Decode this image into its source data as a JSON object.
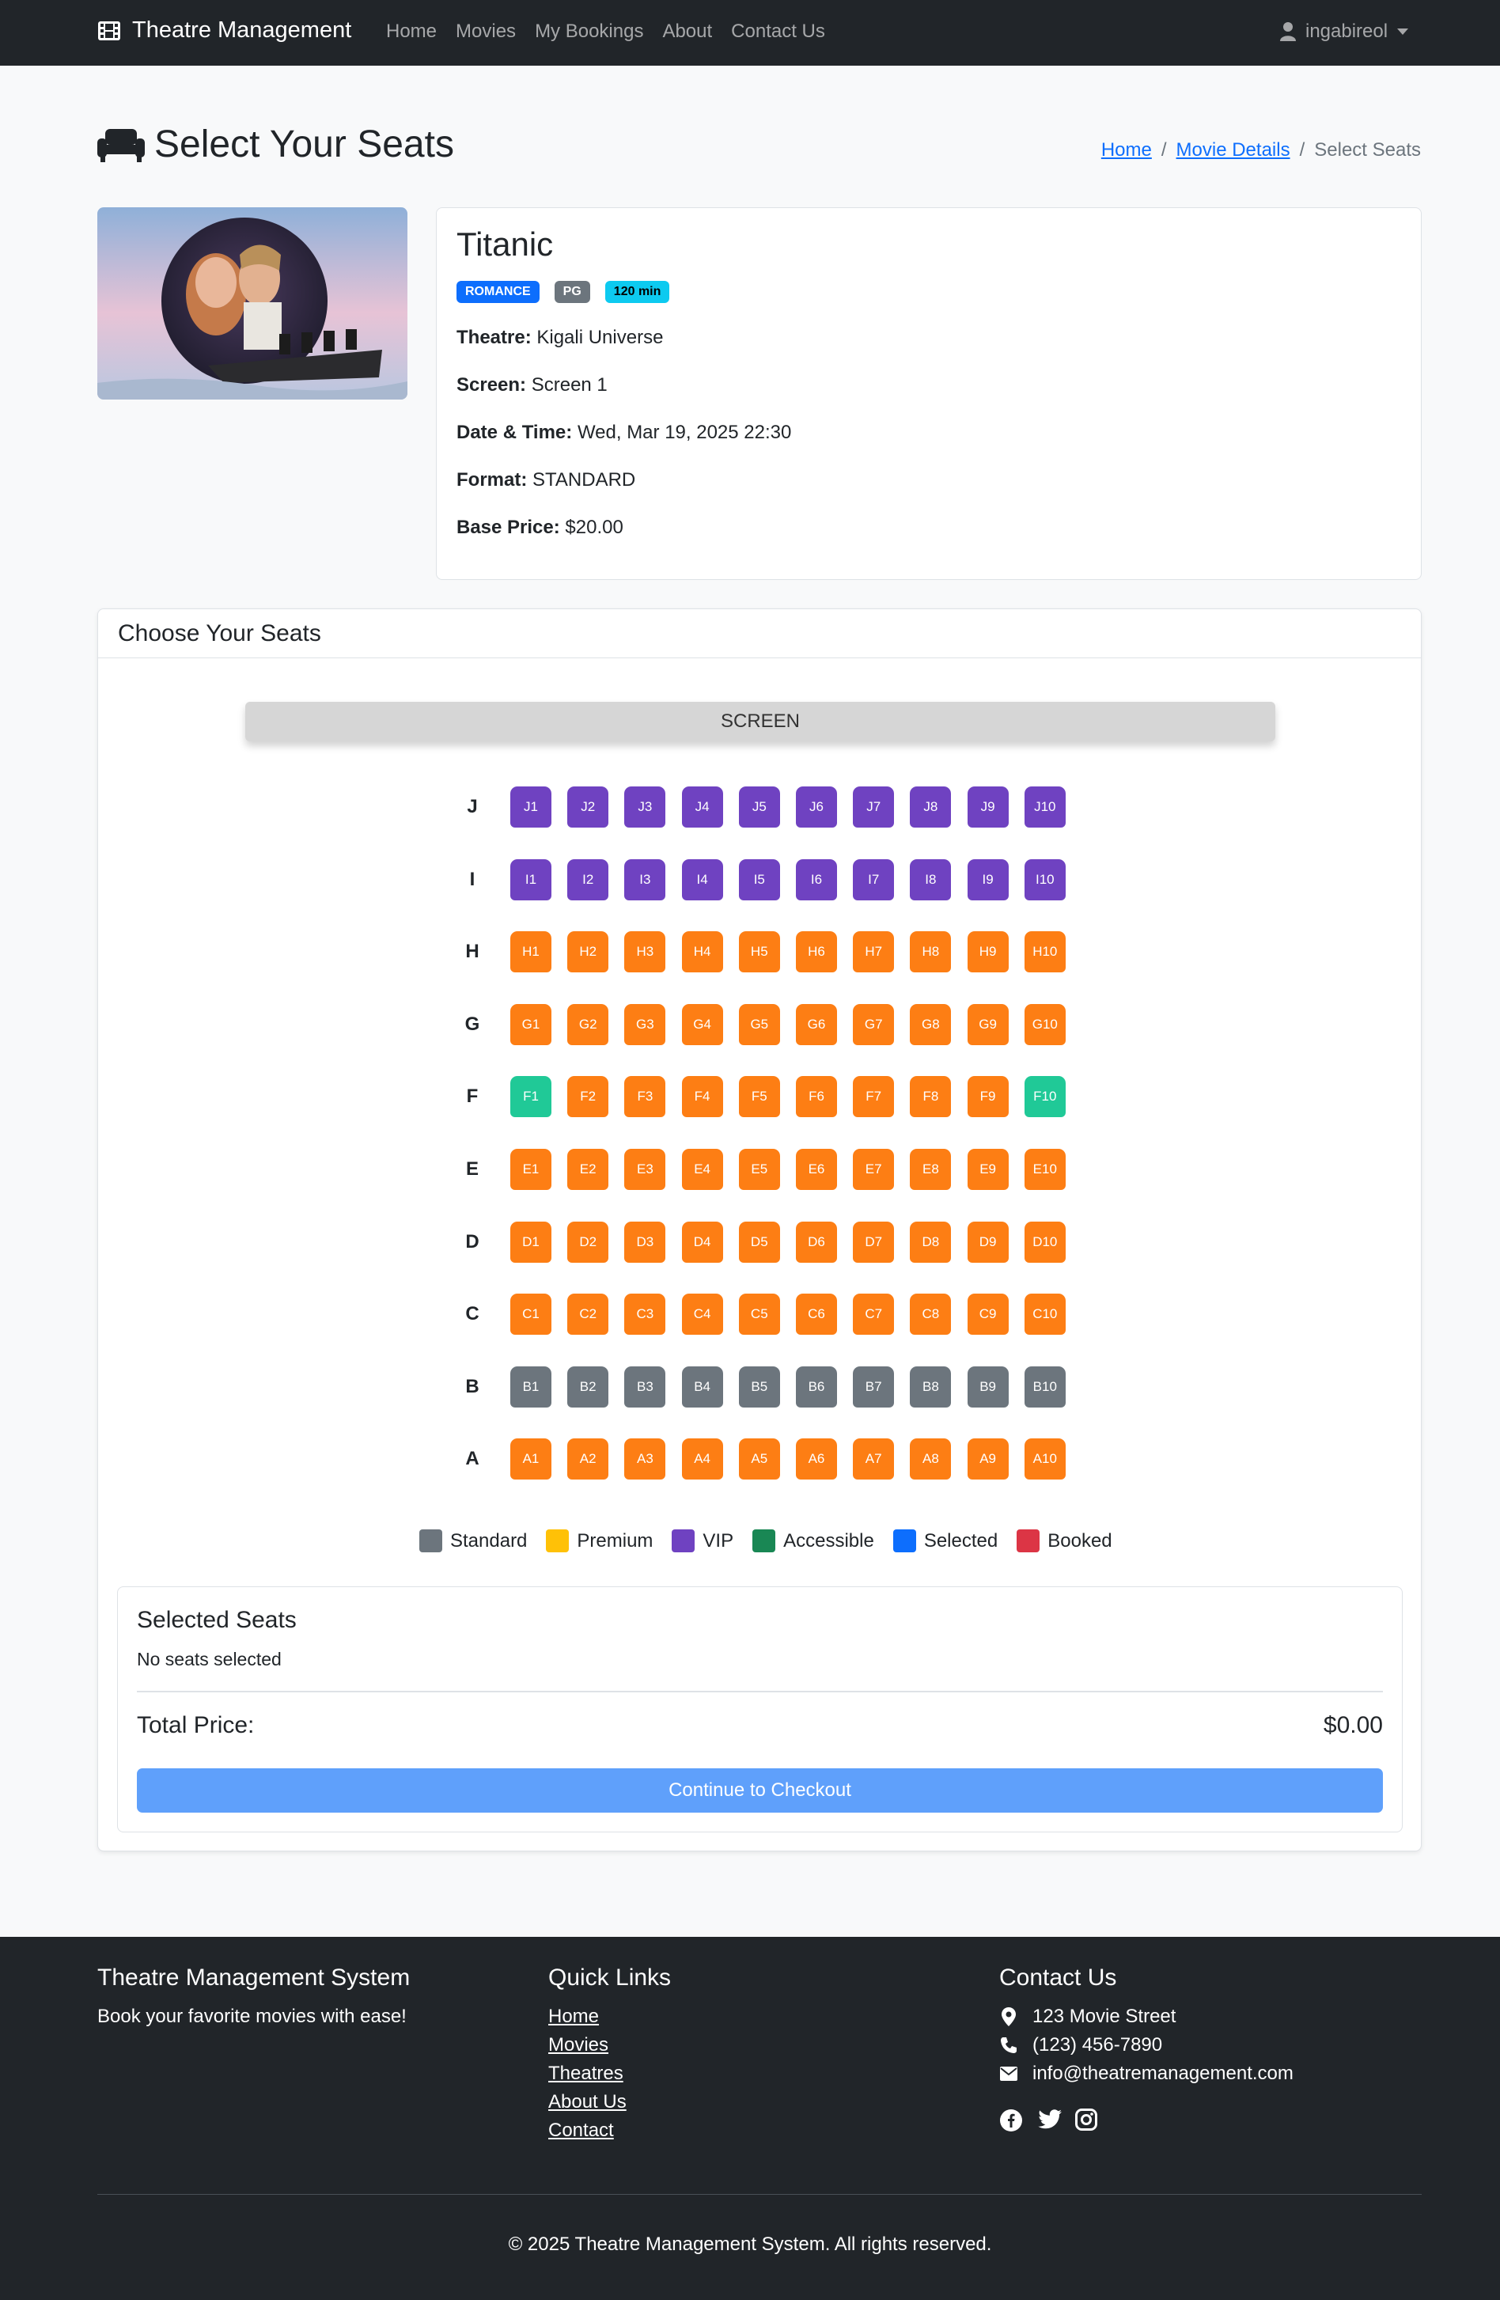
{
  "navbar": {
    "brand": "Theatre Management",
    "links": [
      "Home",
      "Movies",
      "My Bookings",
      "About",
      "Contact Us"
    ],
    "user": "ingabireol"
  },
  "header": {
    "title": "Select Your Seats",
    "breadcrumb": {
      "home": "Home",
      "movie_details": "Movie Details",
      "current": "Select Seats",
      "separator": "/"
    }
  },
  "movie": {
    "title": "Titanic",
    "genre": "ROMANCE",
    "rating": "PG",
    "duration": "120 min",
    "theatre_label": "Theatre:",
    "theatre": "Kigali Universe",
    "screen_label": "Screen:",
    "screen": "Screen 1",
    "datetime_label": "Date & Time:",
    "datetime": "Wed, Mar 19, 2025 22:30",
    "format_label": "Format:",
    "format": "STANDARD",
    "price_label": "Base Price:",
    "price": "$20.00"
  },
  "seating": {
    "header": "Choose Your Seats",
    "screen_label": "SCREEN",
    "rows": [
      {
        "label": "J",
        "type": "vip"
      },
      {
        "label": "I",
        "type": "vip"
      },
      {
        "label": "H",
        "type": "premium"
      },
      {
        "label": "G",
        "type": "premium"
      },
      {
        "label": "F",
        "type": "premium",
        "accessible_seats": [
          1,
          10
        ]
      },
      {
        "label": "E",
        "type": "premium"
      },
      {
        "label": "D",
        "type": "premium"
      },
      {
        "label": "C",
        "type": "premium"
      },
      {
        "label": "B",
        "type": "standard"
      },
      {
        "label": "A",
        "type": "premium"
      }
    ],
    "seats_per_row": 10,
    "colors": {
      "standard": "#6c757d",
      "premium": "#fd7e14",
      "vip": "#6f42c1",
      "accessible": "#20c997"
    },
    "legend": [
      {
        "label": "Standard",
        "color": "#6c757d"
      },
      {
        "label": "Premium",
        "color": "#ffc107"
      },
      {
        "label": "VIP",
        "color": "#6f42c1"
      },
      {
        "label": "Accessible",
        "color": "#198754"
      },
      {
        "label": "Selected",
        "color": "#0d6efd"
      },
      {
        "label": "Booked",
        "color": "#dc3545"
      }
    ]
  },
  "selection": {
    "title": "Selected Seats",
    "empty_text": "No seats selected",
    "total_label": "Total Price:",
    "total_value": "$0.00",
    "checkout_label": "Continue to Checkout"
  },
  "footer": {
    "about_title": "Theatre Management System",
    "tagline": "Book your favorite movies with ease!",
    "links_title": "Quick Links",
    "links": [
      "Home",
      "Movies",
      "Theatres",
      "About Us",
      "Contact"
    ],
    "contact_title": "Contact Us",
    "address": "123 Movie Street",
    "phone": "(123) 456-7890",
    "email": "info@theatremanagement.com",
    "social_icons": [
      "facebook-icon",
      "twitter-icon",
      "instagram-icon"
    ],
    "copyright": "© 2025 Theatre Management System. All rights reserved."
  }
}
